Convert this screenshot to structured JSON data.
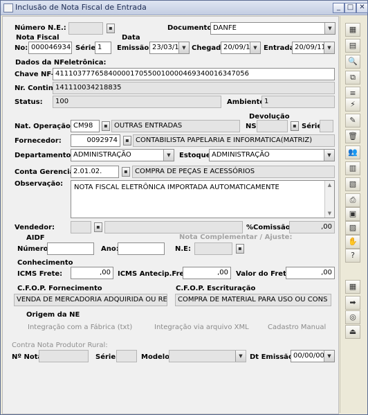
{
  "window": {
    "title": "Inclusão de Nota Fiscal de Entrada",
    "btn_min": "_",
    "btn_max": "□",
    "btn_close": "✕"
  },
  "top": {
    "numero_ne_label": "Número N.E.:",
    "numero_ne_value": "",
    "documento_label": "Documento:",
    "documento_value": "DANFE",
    "nota_fiscal_label": "Nota Fiscal",
    "no_label": "No:",
    "no_value": "000046934",
    "serie_label": "Série:",
    "serie_value": "1",
    "data_label": "Data",
    "emissao_label": "Emissão:",
    "emissao_value": "23/03/11",
    "chegada_label": "Chegada:",
    "chegada_value": "20/09/11",
    "entrada_label": "Entrada:",
    "entrada_value": "20/09/11"
  },
  "nfe": {
    "section_label": "Dados da NFeletrônica:",
    "chave_label": "Chave NF-e:",
    "chave_value": "41110377765840000170550010000469340016347056",
    "conting_label": "Nr. Conting.:",
    "conting_value": "141110034218835",
    "status_label": "Status:",
    "status_value": "100",
    "ambiente_label": "Ambiente:",
    "ambiente_value": "1"
  },
  "operacao": {
    "nat_label": "Nat. Operação:",
    "nat_code": "CM98",
    "nat_desc": "OUTRAS ENTRADAS",
    "devolucao_label": "Devolução",
    "ns_label": "NS:",
    "ns_value": "",
    "serie_label": "Série:",
    "serie_value": "",
    "fornecedor_label": "Fornecedor:",
    "fornecedor_code": "0092974",
    "fornecedor_name": "CONTABILISTA PAPELARIA E INFORMATICA(MATRIZ)",
    "departamento_label": "Departamento:",
    "departamento_value": "ADMINISTRAÇÃO",
    "estoque_label": "Estoque:",
    "estoque_value": "ADMINISTRAÇÃO",
    "conta_label": "Conta Gerencial:",
    "conta_code": "2.01.02.",
    "conta_desc": "COMPRA DE PEÇAS E ACESSÓRIOS",
    "observacao_label": "Observação:",
    "observacao_value": "NOTA FISCAL ELETRÔNICA IMPORTADA AUTOMATICAMENTE"
  },
  "vendedor": {
    "label": "Vendedor:",
    "code": "",
    "name": "",
    "comissao_label": "%Comissão:",
    "comissao_value": ",00"
  },
  "aidf": {
    "label": "AIDF",
    "numero_label": "Número:",
    "numero_value": "",
    "ano_label": "Ano:",
    "ano_value": "",
    "complementar_label": "Nota Complementar / Ajuste:",
    "ne_label": "N.E:",
    "ne_value": ""
  },
  "conhecimento": {
    "label": "Conhecimento",
    "icms_frete_label": "ICMS Frete:",
    "icms_frete_value": ",00",
    "icms_antecip_label": "ICMS Antecip.Frete:",
    "icms_antecip_value": ",00",
    "valor_frete_label": "Valor do Frete:",
    "valor_frete_value": ",00"
  },
  "cfop": {
    "fornecimento_label": "C.F.O.P. Fornecimento",
    "fornecimento_value": "VENDA DE MERCADORIA ADQUIRIDA OU RE",
    "escrituracao_label": "C.F.O.P. Escrituração",
    "escrituracao_value": "COMPRA DE MATERIAL PARA USO OU CONS"
  },
  "origem": {
    "label": "Origem da NE",
    "opt1": "Integração com a Fábrica (txt)",
    "opt2": "Integração via arquivo XML",
    "opt3": "Cadastro Manual"
  },
  "produtor": {
    "label": "Contra Nota Produtor Rural:",
    "nota_label": "Nº Nota:",
    "nota_value": "",
    "serie_label": "Série:",
    "serie_value": "",
    "modelo_label": "Modelo:",
    "modelo_value": "",
    "dt_label": "Dt Emissão:",
    "dt_value": "00/00/00"
  },
  "toolbar": [
    {
      "icon": "grid-add-icon",
      "glyph": "▦"
    },
    {
      "icon": "table-icon",
      "glyph": "▤"
    },
    {
      "icon": "preview-icon",
      "glyph": "🔍"
    },
    {
      "icon": "copy-icon",
      "glyph": "⧉"
    },
    {
      "icon": "list-icon",
      "glyph": "≡"
    },
    {
      "icon": "flash-icon",
      "glyph": "⚡"
    },
    {
      "icon": "edit-icon",
      "glyph": "✎"
    },
    {
      "icon": "trash-icon",
      "glyph": "🗑"
    },
    {
      "icon": "users-icon",
      "glyph": "👥"
    },
    {
      "icon": "documents-icon",
      "glyph": "▥"
    },
    {
      "icon": "notes-icon",
      "glyph": "▧"
    },
    {
      "icon": "print-icon",
      "glyph": "⎙"
    },
    {
      "icon": "disk-icon",
      "glyph": "▣"
    },
    {
      "icon": "chart-icon",
      "glyph": "▨"
    },
    {
      "icon": "hand-icon",
      "glyph": "✋"
    },
    {
      "icon": "help-icon",
      "glyph": "?"
    },
    {
      "icon": "calendar-add-icon",
      "glyph": "▦"
    },
    {
      "icon": "arrow-right-icon",
      "glyph": "➡"
    },
    {
      "icon": "binoculars-icon",
      "glyph": "◎"
    },
    {
      "icon": "exit-icon",
      "glyph": "⏏"
    }
  ]
}
